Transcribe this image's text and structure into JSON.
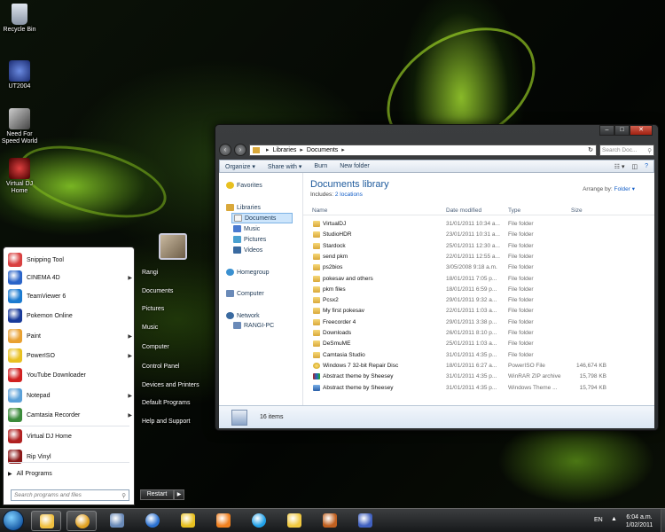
{
  "desktop": {
    "icons": [
      {
        "label": "Recycle Bin",
        "icon": "recycle-bin-icon"
      },
      {
        "label": "UT2004",
        "icon": "ut2004-icon"
      },
      {
        "label": "Need For Speed World",
        "icon": "nfs-world-icon"
      },
      {
        "label": "Virtual DJ Home",
        "icon": "virtualdj-icon"
      }
    ]
  },
  "explorer": {
    "breadcrumb": [
      "Libraries",
      "Documents"
    ],
    "search_placeholder": "Search Doc...",
    "toolbar": {
      "organize": "Organize",
      "share_with": "Share with",
      "burn": "Burn",
      "new_folder": "New folder"
    },
    "nav": {
      "favorites": "Favorites",
      "libraries": "Libraries",
      "documents": "Documents",
      "music": "Music",
      "pictures": "Pictures",
      "videos": "Videos",
      "homegroup": "Homegroup",
      "computer": "Computer",
      "network": "Network",
      "rangi_pc": "RANGI-PC"
    },
    "library_title": "Documents library",
    "includes_label": "Includes:",
    "includes_link": "2 locations",
    "arrange_label": "Arrange by:",
    "arrange_value": "Folder",
    "columns": {
      "name": "Name",
      "date": "Date modified",
      "type": "Type",
      "size": "Size"
    },
    "files": [
      {
        "name": "VirtualDJ",
        "date": "31/01/2011 10:34 a...",
        "type": "File folder",
        "size": "",
        "kind": "folder"
      },
      {
        "name": "StudioHDR",
        "date": "23/01/2011 10:31 a...",
        "type": "File folder",
        "size": "",
        "kind": "folder"
      },
      {
        "name": "Stardock",
        "date": "25/01/2011 12:30 a...",
        "type": "File folder",
        "size": "",
        "kind": "folder"
      },
      {
        "name": "send pkm",
        "date": "22/01/2011 12:55 a...",
        "type": "File folder",
        "size": "",
        "kind": "folder"
      },
      {
        "name": "ps2bios",
        "date": "3/05/2008 9:18 a.m.",
        "type": "File folder",
        "size": "",
        "kind": "folder"
      },
      {
        "name": "pokesav and others",
        "date": "18/01/2011 7:05 p...",
        "type": "File folder",
        "size": "",
        "kind": "folder"
      },
      {
        "name": "pkm files",
        "date": "18/01/2011 6:59 p...",
        "type": "File folder",
        "size": "",
        "kind": "folder"
      },
      {
        "name": "Pcsx2",
        "date": "29/01/2011 9:32 a...",
        "type": "File folder",
        "size": "",
        "kind": "folder"
      },
      {
        "name": "My first pokesav",
        "date": "22/01/2011 1:03 a...",
        "type": "File folder",
        "size": "",
        "kind": "folder"
      },
      {
        "name": "Freecorder 4",
        "date": "29/01/2011 3:38 p...",
        "type": "File folder",
        "size": "",
        "kind": "folder"
      },
      {
        "name": "Downloads",
        "date": "26/01/2011 8:10 p...",
        "type": "File folder",
        "size": "",
        "kind": "folder"
      },
      {
        "name": "DeSmuME",
        "date": "25/01/2011 1:03 a...",
        "type": "File folder",
        "size": "",
        "kind": "folder"
      },
      {
        "name": "Camtasia Studio",
        "date": "31/01/2011 4:35 p...",
        "type": "File folder",
        "size": "",
        "kind": "folder"
      },
      {
        "name": "Windows 7 32-bit Repair Disc",
        "date": "18/01/2011 6:27 a...",
        "type": "PowerISO File",
        "size": "146,674 KB",
        "kind": "iso"
      },
      {
        "name": "Abstract theme by Sheesey",
        "date": "31/01/2011 4:35 p...",
        "type": "WinRAR ZIP archive",
        "size": "15,798 KB",
        "kind": "rar"
      },
      {
        "name": "Abstract theme by Sheesey",
        "date": "31/01/2011 4:35 p...",
        "type": "Windows Theme ...",
        "size": "15,794 KB",
        "kind": "theme"
      }
    ],
    "item_count": "16 items"
  },
  "start_menu": {
    "programs": [
      {
        "label": "Snipping Tool",
        "arrow": false,
        "color": "#d94040"
      },
      {
        "label": "CINEMA 4D",
        "arrow": true,
        "color": "#2a64c8"
      },
      {
        "label": "TeamViewer 6",
        "arrow": false,
        "color": "#1a7ad0"
      },
      {
        "label": "Pokemon Online",
        "arrow": false,
        "color": "#183a9a"
      },
      {
        "label": "Paint",
        "arrow": true,
        "color": "#e8a030"
      },
      {
        "label": "PowerISO",
        "arrow": true,
        "color": "#e8c020"
      },
      {
        "label": "YouTube Downloader",
        "arrow": false,
        "color": "#d02020"
      },
      {
        "label": "Notepad",
        "arrow": true,
        "color": "#5aa0d8"
      },
      {
        "label": "Camtasia Recorder",
        "arrow": true,
        "color": "#3a8a3a"
      },
      {
        "label": "Virtual DJ Home",
        "arrow": false,
        "color": "#b02020"
      },
      {
        "label": "Rip Vinyl",
        "arrow": false,
        "color": "#8a1818"
      }
    ],
    "all_programs": "All Programs",
    "search_placeholder": "Search programs and files",
    "right_items": [
      "Rangi",
      "Documents",
      "Pictures",
      "Music",
      "Computer",
      "Control Panel",
      "Devices and Printers",
      "Default Programs",
      "Help and Support"
    ],
    "restart": "Restart"
  },
  "taskbar": {
    "language": "EN",
    "time": "6:04 a.m.",
    "date": "1/02/2011",
    "items": [
      {
        "icon": "explorer-icon",
        "color": "#f0c040",
        "pinned": true
      },
      {
        "icon": "chrome-icon",
        "color": "#e0a020",
        "pinned": true
      },
      {
        "icon": "computer-icon",
        "color": "#6a8ab8",
        "pinned": false
      },
      {
        "icon": "globe-icon",
        "color": "#2a70d0",
        "pinned": false
      },
      {
        "icon": "aim-icon",
        "color": "#e8c020",
        "pinned": false
      },
      {
        "icon": "media-player-icon",
        "color": "#f08020",
        "pinned": false
      },
      {
        "icon": "skype-icon",
        "color": "#20a0e8",
        "pinned": false
      },
      {
        "icon": "sunflower-icon",
        "color": "#f0c840",
        "pinned": false
      },
      {
        "icon": "game-icon",
        "color": "#c06020",
        "pinned": false
      },
      {
        "icon": "ut2004-icon",
        "color": "#4060c0",
        "pinned": false
      }
    ]
  }
}
